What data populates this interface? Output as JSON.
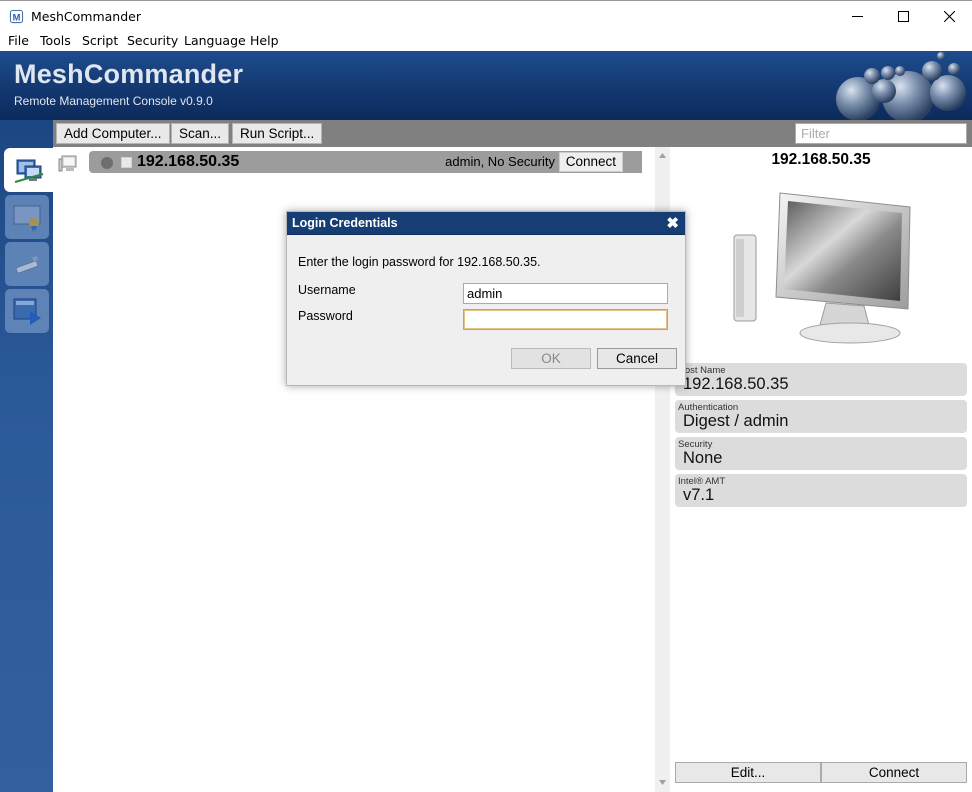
{
  "window": {
    "title": "MeshCommander",
    "controls": {
      "minimize": "minimize",
      "maximize": "maximize",
      "close": "close"
    }
  },
  "menu": [
    "File",
    "Tools",
    "Script",
    "Security",
    "Language",
    "Help"
  ],
  "header": {
    "brand": "MeshCommander",
    "subtitle": "Remote Management Console v0.9.0"
  },
  "sidebar": [
    {
      "icon": "computers-icon",
      "active": true
    },
    {
      "icon": "certificate-icon",
      "active": false
    },
    {
      "icon": "usb-key-icon",
      "active": false
    },
    {
      "icon": "script-play-icon",
      "active": false
    }
  ],
  "toolbar": {
    "add_computer": "Add Computer...",
    "scan": "Scan...",
    "run_script": "Run Script...",
    "filter_placeholder": "Filter"
  },
  "devices": [
    {
      "ip": "192.168.50.35",
      "status": "admin, No Security",
      "connect_label": "Connect"
    }
  ],
  "details": {
    "title": "192.168.50.35",
    "fields": [
      {
        "label": "Host Name",
        "value": "192.168.50.35"
      },
      {
        "label": "Authentication",
        "value": "Digest / admin"
      },
      {
        "label": "Security",
        "value": "None"
      },
      {
        "label": "Intel® AMT",
        "value": "v7.1"
      }
    ],
    "edit_label": "Edit...",
    "connect_label": "Connect"
  },
  "dialog": {
    "title": "Login Credentials",
    "close_glyph": "✖",
    "message": "Enter the login password for 192.168.50.35.",
    "username_label": "Username",
    "username_value": "admin",
    "password_label": "Password",
    "password_value": "",
    "ok_label": "OK",
    "cancel_label": "Cancel"
  }
}
